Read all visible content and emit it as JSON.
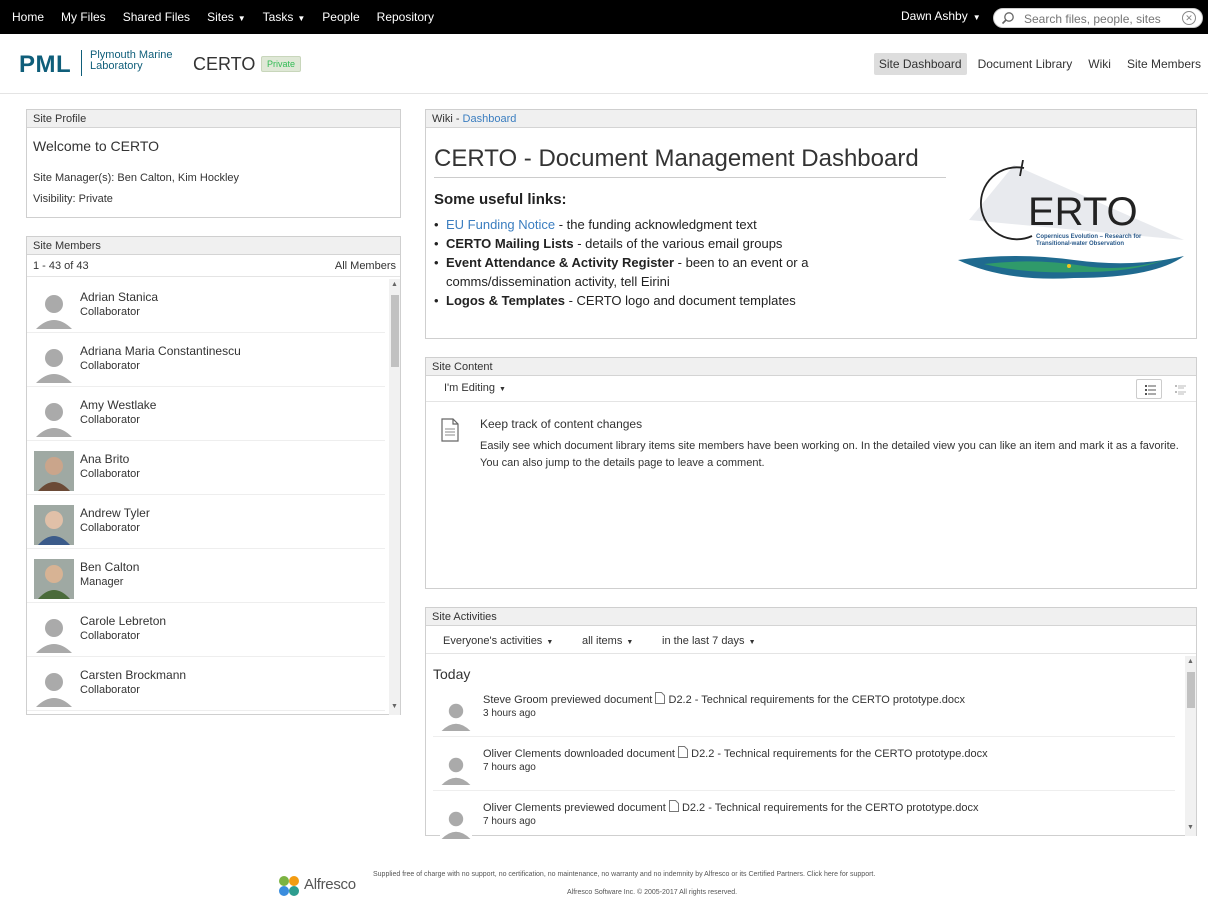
{
  "topbar": {
    "nav": [
      "Home",
      "My Files",
      "Shared Files",
      "Sites",
      "Tasks",
      "People",
      "Repository"
    ],
    "user": "Dawn Ashby",
    "search_placeholder": "Search files, people, sites"
  },
  "header": {
    "logo": "PML",
    "logo_sub1": "Plymouth Marine",
    "logo_sub2": "Laboratory",
    "site_title": "CERTO",
    "visibility_badge": "Private",
    "nav": [
      "Site Dashboard",
      "Document Library",
      "Wiki",
      "Site Members"
    ],
    "active_nav": "Site Dashboard"
  },
  "profile": {
    "title": "Site Profile",
    "welcome": "Welcome to CERTO",
    "managers": "Site Manager(s): Ben Calton, Kim Hockley",
    "visibility": "Visibility: Private"
  },
  "members": {
    "title": "Site Members",
    "count": "1 - 43 of 43",
    "all_link": "All Members",
    "list": [
      {
        "name": "Adrian Stanica",
        "role": "Collaborator",
        "photo": "none"
      },
      {
        "name": "Adriana Maria Constantinescu",
        "role": "Collaborator",
        "photo": "none"
      },
      {
        "name": "Amy Westlake",
        "role": "Collaborator",
        "photo": "none"
      },
      {
        "name": "Ana Brito",
        "role": "Collaborator",
        "photo": "photo"
      },
      {
        "name": "Andrew Tyler",
        "role": "Collaborator",
        "photo": "photo"
      },
      {
        "name": "Ben Calton",
        "role": "Manager",
        "photo": "photo"
      },
      {
        "name": "Carole Lebreton",
        "role": "Collaborator",
        "photo": "none"
      },
      {
        "name": "Carsten Brockmann",
        "role": "Collaborator",
        "photo": "none"
      }
    ]
  },
  "wiki": {
    "title_prefix": "Wiki - ",
    "title_link": "Dashboard",
    "heading": "CERTO - Document Management Dashboard",
    "subheading": "Some useful links:",
    "links": [
      {
        "label": "EU Funding Notice",
        "rest": " - the funding acknowledgment text",
        "style": "blue"
      },
      {
        "label": "CERTO Mailing Lists",
        "rest": " - details of the various email groups",
        "style": "bold"
      },
      {
        "label": "Event Attendance & Activity Register",
        "rest": " - been to an event or a comms/dissemination activity, tell Eirini",
        "style": "bold"
      },
      {
        "label": "Logos & Templates",
        "rest": " - CERTO logo and document templates",
        "style": "bold"
      }
    ],
    "logo_word": "ERTO",
    "logo_tag1": "Copernicus Evolution – Research for",
    "logo_tag2": "Transitional-water Observation"
  },
  "site_content": {
    "title": "Site Content",
    "filter": "I'm Editing",
    "empty_heading": "Keep track of content changes",
    "empty_text": "Easily see which document library items site members have been working on. In the detailed view you can like an item and mark it as a favorite. You can also jump to the details page to leave a comment."
  },
  "activities": {
    "title": "Site Activities",
    "filters": [
      "Everyone's activities",
      "all items",
      "in the last 7 days"
    ],
    "group": "Today",
    "items": [
      {
        "text": "Steve Groom previewed document",
        "doc": "D2.2 - Technical requirements for the CERTO prototype.docx",
        "time": "3 hours ago"
      },
      {
        "text": "Oliver Clements downloaded document",
        "doc": "D2.2 - Technical requirements for the CERTO prototype.docx",
        "time": "7 hours ago"
      },
      {
        "text": "Oliver Clements previewed document",
        "doc": "D2.2 - Technical requirements for the CERTO prototype.docx",
        "time": "7 hours ago"
      }
    ]
  },
  "footer": {
    "brand": "Alfresco",
    "line1": "Supplied free of charge with no support, no certification, no maintenance, no warranty and no indemnity by Alfresco or its Certified Partners. Click here for support.",
    "line2": "Alfresco Software Inc. © 2005-2017 All rights reserved."
  },
  "colors": {
    "accent": "#3b7ec0",
    "brand": "#0f5e7a",
    "topbar": "#000000"
  },
  "icons": [
    "search-icon",
    "clear-icon",
    "caret-down-icon",
    "document-icon",
    "list-view-icon",
    "detailed-view-icon",
    "avatar-placeholder-icon"
  ]
}
